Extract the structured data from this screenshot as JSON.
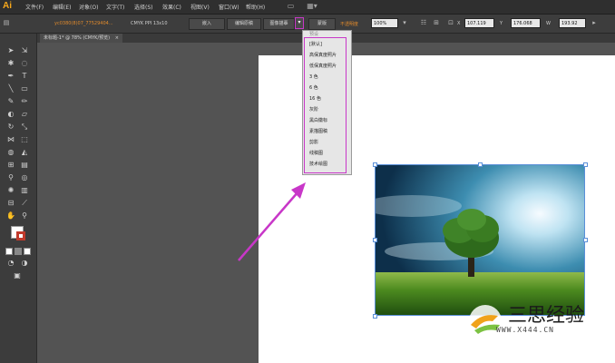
{
  "app": {
    "logo": "Ai"
  },
  "menubar": {
    "items": [
      "文件(F)",
      "编辑(E)",
      "对象(O)",
      "文字(T)",
      "选择(S)",
      "效果(C)",
      "视图(V)",
      "窗口(W)",
      "帮助(H)"
    ]
  },
  "controlbar": {
    "filename": "yc0380(8)07_77529404...",
    "color_info": "CMYK  PPI  13x10",
    "embed_button": "嵌入",
    "edit_original_button": "编辑原稿",
    "image_trace_button": "图像描摹",
    "mask_button": "蒙版",
    "opacity_label": "不透明度",
    "opacity_value": "100%",
    "x_value": "107.119",
    "y_value": "176.068",
    "w_value": "193.92"
  },
  "document_tab": {
    "label": "未标题-1* @ 78% (CMYK/预览)",
    "close": "×"
  },
  "preset_menu": {
    "header": "预设",
    "items": [
      "[默认]",
      "高保真度照片",
      "低保真度照片",
      "3 色",
      "6 色",
      "16 色",
      "灰阶",
      "黑白徽标",
      "素描图稿",
      "剪影",
      "线稿图",
      "技术绘图"
    ]
  },
  "watermark": {
    "title": "三思经验",
    "url": "WWW.X444.CN"
  },
  "colors": {
    "accent_highlight": "#c837c8",
    "ai_logo": "#f7a81b",
    "selection": "#5a8fd8"
  }
}
